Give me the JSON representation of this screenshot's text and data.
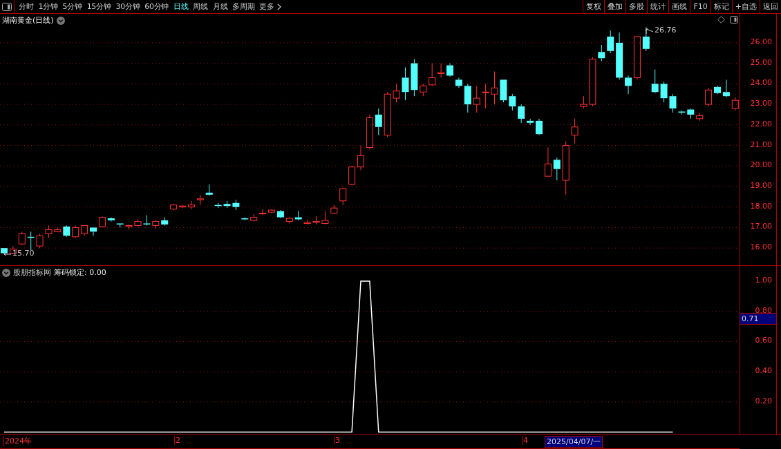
{
  "toolbar": {
    "periods": [
      {
        "label": "分时",
        "selected": false
      },
      {
        "label": "1分钟",
        "selected": false
      },
      {
        "label": "5分钟",
        "selected": false
      },
      {
        "label": "15分钟",
        "selected": false
      },
      {
        "label": "30分钟",
        "selected": false
      },
      {
        "label": "60分钟",
        "selected": false
      },
      {
        "label": "日线",
        "selected": true
      },
      {
        "label": "周线",
        "selected": false
      },
      {
        "label": "月线",
        "selected": false
      },
      {
        "label": "多周期",
        "selected": false
      }
    ],
    "more": "更多",
    "actions": [
      "复权",
      "叠加",
      "多股",
      "统计",
      "画线",
      "F10",
      "标记",
      "+自选",
      "返回"
    ]
  },
  "price_chart": {
    "title": "湖南黄金(日线)",
    "high_marker": "26.76",
    "low_marker": "15.70",
    "chart_data": {
      "type": "candlestick",
      "ylim": [
        15.13,
        27.41
      ],
      "grid": true,
      "yticks": [
        {
          "value": 26,
          "label": "26.00"
        },
        {
          "value": 25,
          "label": "25.00"
        },
        {
          "value": 24,
          "label": "24.00"
        },
        {
          "value": 23,
          "label": "23.00"
        },
        {
          "value": 22,
          "label": "22.00"
        },
        {
          "value": 21,
          "label": "21.00"
        },
        {
          "value": 20,
          "label": "20.00"
        },
        {
          "value": 19,
          "label": "19.00"
        },
        {
          "value": 18,
          "label": "18.00"
        },
        {
          "value": 17,
          "label": "17.00"
        },
        {
          "value": 16,
          "label": "16.00"
        }
      ],
      "ohlc": [
        [
          16.0,
          16.0,
          15.7,
          15.75
        ],
        [
          15.75,
          16.1,
          15.7,
          15.95
        ],
        [
          16.2,
          16.8,
          16.15,
          16.7
        ],
        [
          16.55,
          16.8,
          15.9,
          16.5
        ],
        [
          16.1,
          16.7,
          16.0,
          16.6
        ],
        [
          16.7,
          17.1,
          16.5,
          16.9
        ],
        [
          16.8,
          17.0,
          16.8,
          16.9
        ],
        [
          17.05,
          17.1,
          16.55,
          16.6
        ],
        [
          16.55,
          17.1,
          16.5,
          17.0
        ],
        [
          16.7,
          17.1,
          16.6,
          17.1
        ],
        [
          17.0,
          17.0,
          16.6,
          16.8
        ],
        [
          17.05,
          17.55,
          17.0,
          17.5
        ],
        [
          17.45,
          17.5,
          17.3,
          17.35
        ],
        [
          17.2,
          17.2,
          17.0,
          17.15
        ],
        [
          17.05,
          17.15,
          16.9,
          17.1
        ],
        [
          17.1,
          17.4,
          17.05,
          17.3
        ],
        [
          17.2,
          17.6,
          17.1,
          17.15
        ],
        [
          17.1,
          17.35,
          16.95,
          17.3
        ],
        [
          17.35,
          17.5,
          17.1,
          17.15
        ],
        [
          17.9,
          18.15,
          17.85,
          18.1
        ],
        [
          18.0,
          18.1,
          17.95,
          18.05
        ],
        [
          18.0,
          18.3,
          17.9,
          18.1
        ],
        [
          18.35,
          18.6,
          18.1,
          18.4
        ],
        [
          18.7,
          19.1,
          18.55,
          18.6
        ],
        [
          18.1,
          18.2,
          17.95,
          18.05
        ],
        [
          18.15,
          18.3,
          17.95,
          18.05
        ],
        [
          18.2,
          18.35,
          17.85,
          18.0
        ],
        [
          17.45,
          17.5,
          17.35,
          17.4
        ],
        [
          17.35,
          17.65,
          17.3,
          17.5
        ],
        [
          17.7,
          17.9,
          17.6,
          17.7
        ],
        [
          17.75,
          17.9,
          17.7,
          17.85
        ],
        [
          17.8,
          17.85,
          17.45,
          17.5
        ],
        [
          17.3,
          17.5,
          17.2,
          17.45
        ],
        [
          17.5,
          17.8,
          17.35,
          17.4
        ],
        [
          17.2,
          17.35,
          17.15,
          17.25
        ],
        [
          17.25,
          17.55,
          17.15,
          17.3
        ],
        [
          17.2,
          17.8,
          17.15,
          17.35
        ],
        [
          17.7,
          18.1,
          17.65,
          17.95
        ],
        [
          18.3,
          18.95,
          18.1,
          18.9
        ],
        [
          19.1,
          20.0,
          19.05,
          19.95
        ],
        [
          19.95,
          21.0,
          19.8,
          20.5
        ],
        [
          20.9,
          22.5,
          20.8,
          22.35
        ],
        [
          22.5,
          22.8,
          21.5,
          21.9
        ],
        [
          21.5,
          23.6,
          21.4,
          23.5
        ],
        [
          23.3,
          24.0,
          23.1,
          23.65
        ],
        [
          24.3,
          24.8,
          23.2,
          23.6
        ],
        [
          25.0,
          25.2,
          23.4,
          23.7
        ],
        [
          23.6,
          24.0,
          23.4,
          23.9
        ],
        [
          23.95,
          25.0,
          23.9,
          24.3
        ],
        [
          24.5,
          25.0,
          24.3,
          24.55
        ],
        [
          24.9,
          25.0,
          24.35,
          24.4
        ],
        [
          24.2,
          24.3,
          23.8,
          23.9
        ],
        [
          23.9,
          24.0,
          22.6,
          23.0
        ],
        [
          23.0,
          23.9,
          22.6,
          23.3
        ],
        [
          23.6,
          24.0,
          22.8,
          23.6
        ],
        [
          23.5,
          24.6,
          23.0,
          23.8
        ],
        [
          24.2,
          24.2,
          23.1,
          23.2
        ],
        [
          23.4,
          23.5,
          22.7,
          22.9
        ],
        [
          22.9,
          23.0,
          22.1,
          22.3
        ],
        [
          22.2,
          22.3,
          22.0,
          22.1
        ],
        [
          22.2,
          22.3,
          21.5,
          21.55
        ],
        [
          19.5,
          20.9,
          19.5,
          20.1
        ],
        [
          20.3,
          20.4,
          19.3,
          19.85
        ],
        [
          19.3,
          21.2,
          18.6,
          21.0
        ],
        [
          21.5,
          22.3,
          21.1,
          21.9
        ],
        [
          22.9,
          23.4,
          22.8,
          23.0
        ],
        [
          23.0,
          25.3,
          22.9,
          25.2
        ],
        [
          25.55,
          25.9,
          25.1,
          25.25
        ],
        [
          26.3,
          26.6,
          25.5,
          25.6
        ],
        [
          26.0,
          26.5,
          24.2,
          24.3
        ],
        [
          24.3,
          24.4,
          23.5,
          23.9
        ],
        [
          24.3,
          26.3,
          24.2,
          26.3
        ],
        [
          26.3,
          26.76,
          25.6,
          25.7
        ],
        [
          24.0,
          24.7,
          23.55,
          23.6
        ],
        [
          24.0,
          24.1,
          23.1,
          23.3
        ],
        [
          23.4,
          23.5,
          22.6,
          22.8
        ],
        [
          22.65,
          22.7,
          22.5,
          22.6
        ],
        [
          22.75,
          22.8,
          22.3,
          22.5
        ],
        [
          22.3,
          22.6,
          22.2,
          22.45
        ],
        [
          23.0,
          23.8,
          22.9,
          23.7
        ],
        [
          23.85,
          23.9,
          23.5,
          23.55
        ],
        [
          23.6,
          24.2,
          23.35,
          23.4
        ],
        [
          22.8,
          23.35,
          22.7,
          23.2
        ]
      ]
    }
  },
  "indicator": {
    "source": "股朋指标网",
    "value": "0.00",
    "cursor_value": "0.71",
    "chart_data": {
      "type": "line",
      "ylim": [
        -0.02,
        1.1
      ],
      "grid": true,
      "yticks": [
        {
          "value": 1.0,
          "label": "1.00"
        },
        {
          "value": 0.8,
          "label": "0.80"
        },
        {
          "value": 0.6,
          "label": "0.60"
        },
        {
          "value": 0.4,
          "label": "0.40"
        },
        {
          "value": 0.2,
          "label": "0.20"
        }
      ],
      "series": [
        {
          "name": "筹码锁定:",
          "color": "#ffffff",
          "values": [
            0,
            0,
            0,
            0,
            0,
            0,
            0,
            0,
            0,
            0,
            0,
            0,
            0,
            0,
            0,
            0,
            0,
            0,
            0,
            0,
            0,
            0,
            0,
            0,
            0,
            0,
            0,
            0,
            0,
            0,
            0,
            0,
            0,
            0,
            0,
            0,
            0,
            0,
            0,
            0,
            1,
            1,
            0,
            0,
            0,
            0,
            0,
            0,
            0,
            0,
            0,
            0,
            0,
            0,
            0,
            0,
            0,
            0,
            0,
            0,
            0,
            0,
            0,
            0,
            0,
            0,
            0,
            0,
            0,
            0,
            0,
            0,
            0,
            0,
            0,
            0,
            null,
            null,
            null,
            null,
            null,
            null,
            null
          ]
        }
      ]
    }
  },
  "date_axis": {
    "labels": [
      "2024年",
      "2",
      "3",
      "4"
    ],
    "cursor_date": "2025/04/07/一"
  }
}
